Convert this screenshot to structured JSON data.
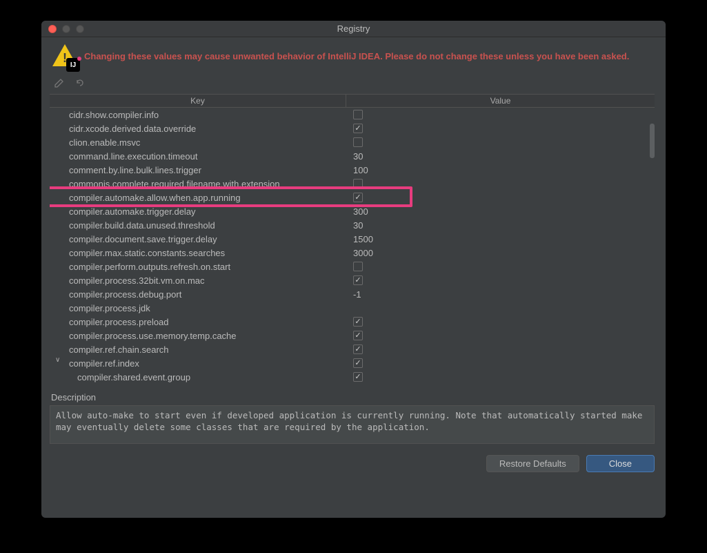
{
  "window": {
    "title": "Registry"
  },
  "warning": {
    "text": "Changing these values may cause unwanted behavior of IntelliJ IDEA. Please do not change these unless you have been asked."
  },
  "table": {
    "headers": {
      "key": "Key",
      "value": "Value"
    },
    "rows": [
      {
        "key": "cidr.show.compiler.info",
        "value_type": "check",
        "checked": false,
        "expand": false
      },
      {
        "key": "cidr.xcode.derived.data.override",
        "value_type": "check",
        "checked": true,
        "expand": false
      },
      {
        "key": "clion.enable.msvc",
        "value_type": "check",
        "checked": false,
        "expand": false
      },
      {
        "key": "command.line.execution.timeout",
        "value_type": "text",
        "value": "30",
        "expand": false
      },
      {
        "key": "comment.by.line.bulk.lines.trigger",
        "value_type": "text",
        "value": "100",
        "expand": false
      },
      {
        "key": "commonjs.complete.required.filename.with.extension",
        "value_type": "check",
        "checked": false,
        "expand": false
      },
      {
        "key": "compiler.automake.allow.when.app.running",
        "value_type": "check",
        "checked": true,
        "expand": false,
        "highlighted": true
      },
      {
        "key": "compiler.automake.trigger.delay",
        "value_type": "text",
        "value": "300",
        "expand": false
      },
      {
        "key": "compiler.build.data.unused.threshold",
        "value_type": "text",
        "value": "30",
        "expand": false
      },
      {
        "key": "compiler.document.save.trigger.delay",
        "value_type": "text",
        "value": "1500",
        "expand": false
      },
      {
        "key": "compiler.max.static.constants.searches",
        "value_type": "text",
        "value": "3000",
        "expand": false
      },
      {
        "key": "compiler.perform.outputs.refresh.on.start",
        "value_type": "check",
        "checked": false,
        "expand": false
      },
      {
        "key": "compiler.process.32bit.vm.on.mac",
        "value_type": "check",
        "checked": true,
        "expand": false
      },
      {
        "key": "compiler.process.debug.port",
        "value_type": "text",
        "value": "-1",
        "expand": false
      },
      {
        "key": "compiler.process.jdk",
        "value_type": "text",
        "value": "",
        "expand": false
      },
      {
        "key": "compiler.process.preload",
        "value_type": "check",
        "checked": true,
        "expand": false
      },
      {
        "key": "compiler.process.use.memory.temp.cache",
        "value_type": "check",
        "checked": true,
        "expand": false
      },
      {
        "key": "compiler.ref.chain.search",
        "value_type": "check",
        "checked": true,
        "expand": false
      },
      {
        "key": "compiler.ref.index",
        "value_type": "check",
        "checked": true,
        "expand": true
      },
      {
        "key": "compiler.shared.event.group",
        "value_type": "check",
        "checked": true,
        "expand": false
      }
    ]
  },
  "description": {
    "label": "Description",
    "text": "Allow auto-make to start even if developed application is currently running. Note that automatically started make may eventually delete some classes that are required by the application."
  },
  "buttons": {
    "restore": "Restore Defaults",
    "close": "Close"
  }
}
